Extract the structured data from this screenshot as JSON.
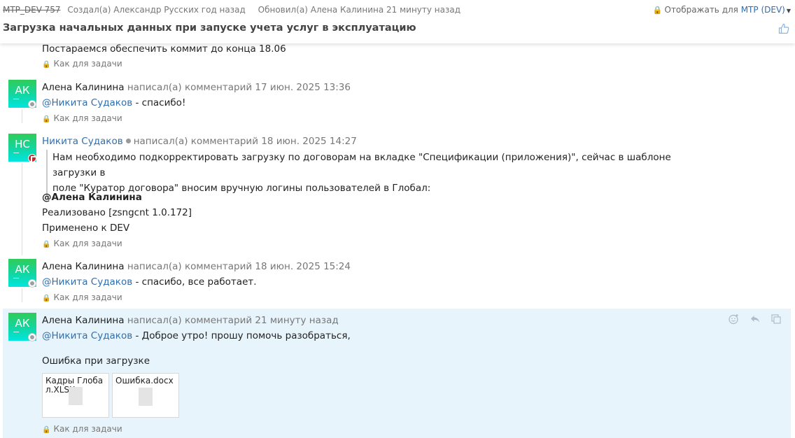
{
  "header": {
    "issue_key": "MTP_DEV-757",
    "created": "Создал(а) Александр Русских год назад",
    "updated": "Обновил(а) Алена Калинина 21 минуту назад",
    "visibility_label": "Отображать для",
    "visibility_value": "MTP (DEV)",
    "title": "Загрузка начальных данных при запуске учета услуг в эксплуатацию",
    "icons": {
      "lock": "lock-icon",
      "caret": "caret-down-icon",
      "like": "thumbs-up-icon"
    }
  },
  "restriction_label": "Как для задачи",
  "comments": [
    {
      "body": "Постараемся обеспечить коммит до конца 18.06"
    },
    {
      "initials": "АК",
      "author": "Алена Калинина",
      "action": "написал(а) комментарий 17 июн. 2025 13:36",
      "mention": "@Никита Судаков",
      "text": " - спасибо!"
    },
    {
      "initials": "НС",
      "author": "Никита Судаков",
      "action": "написал(а) комментарий 18 июн. 2025 14:27",
      "quote_line1": "Нам необходимо подкорректировать загрузку по договорам на вкладке \"Спецификации (приложения)\", сейчас в шаблоне загрузки в",
      "quote_line2": "поле \"Куратор договора\" вносим вручную логины пользователей в Глобал:",
      "mention_bold": "@Алена Калинина",
      "line1": "Реализовано [zsngcnt 1.0.172]",
      "line2": "Применено к DEV"
    },
    {
      "initials": "АК",
      "author": "Алена Калинина",
      "action": "написал(а) комментарий 18 июн. 2025 15:24",
      "mention": "@Никита Судаков",
      "text": " - спасибо, все работает."
    },
    {
      "initials": "АК",
      "author": "Алена Калинина",
      "action": "написал(а) комментарий 21 минуту назад",
      "mention": "@Никита Судаков",
      "text": " - Доброе утро! прошу помочь разобраться,",
      "line2": "Ошибка при загрузке",
      "attachments": [
        "Кадры Глобал.XLSX",
        "Ошибка.docx"
      ]
    }
  ],
  "actions": {
    "reaction_icon": "add-reaction-icon",
    "reply_icon": "reply-icon",
    "copy_icon": "copy-link-icon"
  }
}
